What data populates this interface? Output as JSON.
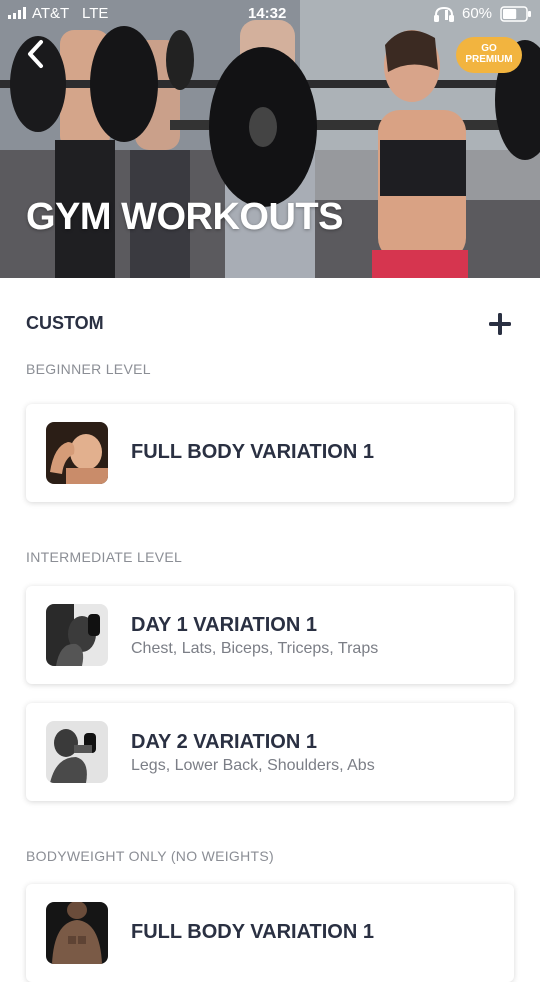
{
  "status_bar": {
    "carrier": "AT&T",
    "network": "LTE",
    "time": "14:32",
    "battery": "60%",
    "battery_level": 0.6,
    "signal_icon": "signal-bars-icon",
    "headphones_icon": "headphones-icon",
    "battery_icon": "battery-icon"
  },
  "header": {
    "title": "GYM WORKOUTS",
    "premium_line1": "GO",
    "premium_line2": "PREMIUM",
    "back_icon": "chevron-left-icon",
    "premium_color": "#f2b43f"
  },
  "custom": {
    "title": "CUSTOM",
    "add_icon": "plus-icon"
  },
  "sections": [
    {
      "label": "BEGINNER LEVEL",
      "workouts": [
        {
          "title": "FULL BODY VARIATION 1",
          "subtitle": ""
        }
      ]
    },
    {
      "label": "INTERMEDIATE LEVEL",
      "workouts": [
        {
          "title": "DAY 1 VARIATION 1",
          "subtitle": "Chest, Lats, Biceps, Triceps, Traps"
        },
        {
          "title": "DAY 2 VARIATION 1",
          "subtitle": "Legs, Lower Back, Shoulders, Abs"
        }
      ]
    },
    {
      "label": "BODYWEIGHT ONLY (NO WEIGHTS)",
      "workouts": [
        {
          "title": "FULL BODY VARIATION 1",
          "subtitle": ""
        }
      ]
    }
  ],
  "colors": {
    "text_dark": "#2a3042",
    "text_muted": "#8b8e95",
    "accent": "#f2b43f"
  }
}
